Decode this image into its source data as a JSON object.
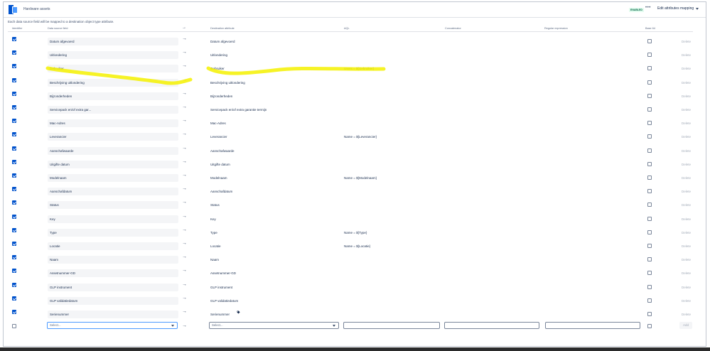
{
  "header": {
    "title": "Hardware assets",
    "status_badge": "ENABLED",
    "more_label": "•••",
    "edit_button_label": "Edit attributes mapping"
  },
  "hint": "Each data source field will be mapped to a destination object type attribute.",
  "columns": {
    "identifier": "Identifier",
    "source": "Data source field",
    "arrow": "→",
    "destination": "Destination attribute",
    "aql": "AQL",
    "concatenator": "Concatenator",
    "regex": "Regular expression",
    "base64": "Base 64"
  },
  "rows": [
    {
      "source": "Datum afgevoerd",
      "destination": "Datum afgevoerd",
      "aql": "",
      "identifier": true,
      "delete": "Delete"
    },
    {
      "source": "Uitlondering",
      "destination": "Uitlondering",
      "aql": "",
      "identifier": true,
      "delete": "Delete"
    },
    {
      "source": "Gebruiker",
      "destination": "Gebruiker",
      "aql": "Users = ${Gebruiker}",
      "identifier": true,
      "delete": "Delete"
    },
    {
      "source": "Beschrijving uitlondering",
      "destination": "Beschrijving uitlondering",
      "aql": "",
      "identifier": true,
      "delete": "Delete"
    },
    {
      "source": "Bijzonderheden",
      "destination": "Bijzonderheden",
      "aql": "",
      "identifier": true,
      "delete": "Delete"
    },
    {
      "source": "Servicepack en/of extra gar...",
      "destination": "Servicepack en/of extra garantie termijn",
      "aql": "",
      "identifier": true,
      "delete": "Delete"
    },
    {
      "source": "Mac-Adres",
      "destination": "Mac-Adres",
      "aql": "",
      "identifier": true,
      "delete": "Delete"
    },
    {
      "source": "Leverancier",
      "destination": "Leverancier",
      "aql": "Name = ${Leverancier}",
      "identifier": true,
      "delete": "Delete"
    },
    {
      "source": "Aanschafwaarde",
      "destination": "Aanschafwaarde",
      "aql": "",
      "identifier": true,
      "delete": "Delete"
    },
    {
      "source": "Uitgifte datum",
      "destination": "Uitgifte datum",
      "aql": "",
      "identifier": true,
      "delete": "Delete"
    },
    {
      "source": "Modelnaam",
      "destination": "Modelnaam",
      "aql": "Name = ${Modelnaam}",
      "identifier": true,
      "delete": "Delete"
    },
    {
      "source": "Aanschafdatum",
      "destination": "Aanschafdatum",
      "aql": "",
      "identifier": true,
      "delete": "Delete"
    },
    {
      "source": "Status",
      "destination": "Status",
      "aql": "",
      "identifier": true,
      "delete": "Delete"
    },
    {
      "source": "Key",
      "destination": "Key",
      "aql": "",
      "identifier": true,
      "delete": "Delete"
    },
    {
      "source": "Type",
      "destination": "Type",
      "aql": "Name = ${Type}",
      "identifier": true,
      "delete": "Delete"
    },
    {
      "source": "Locatie",
      "destination": "Locatie",
      "aql": "Name = ${Locatie}",
      "identifier": true,
      "delete": "Delete"
    },
    {
      "source": "Naam",
      "destination": "Naam",
      "aql": "",
      "identifier": true,
      "delete": "Delete"
    },
    {
      "source": "Assetnummer-GD",
      "destination": "Assetnummer-GD",
      "aql": "",
      "identifier": true,
      "delete": "Delete"
    },
    {
      "source": "GLP instrument",
      "destination": "GLP instrument",
      "aql": "",
      "identifier": true,
      "delete": "Delete"
    },
    {
      "source": "GLP validatiedatum",
      "destination": "GLP validatiedatum",
      "aql": "",
      "identifier": true,
      "delete": "Delete"
    },
    {
      "source": "Serienummer",
      "destination": "Serienummer",
      "aql": "",
      "identifier": true,
      "delete": "Delete"
    }
  ],
  "new_row": {
    "source_placeholder": "Select...",
    "destination_placeholder": "Select...",
    "add_label": "Add"
  },
  "colors": {
    "accent": "#0052cc",
    "highlight": "#f5f100"
  }
}
